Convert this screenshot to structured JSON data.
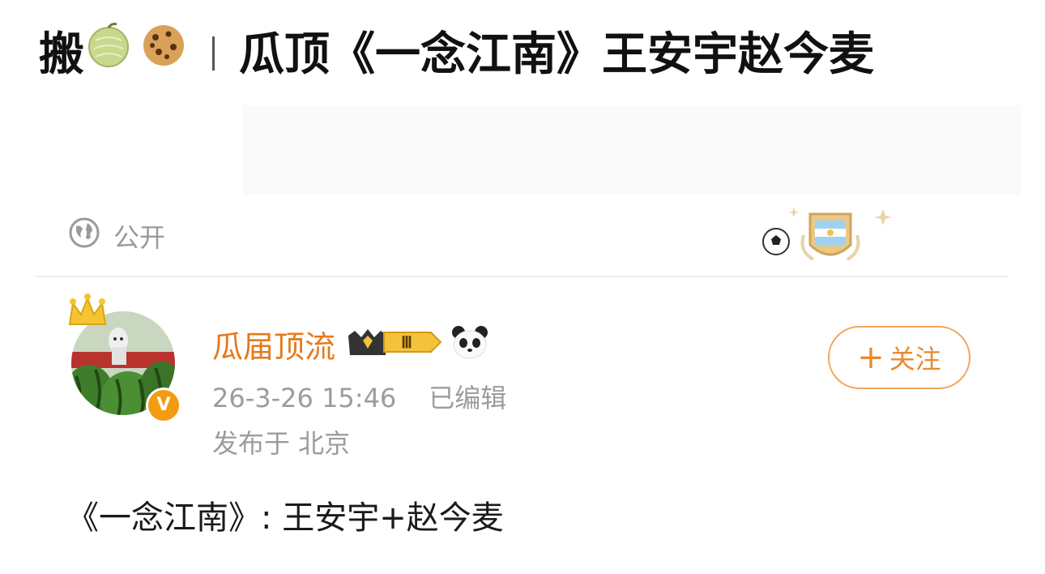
{
  "title": {
    "prefix": "搬",
    "emoji_1": "melon-emoji",
    "emoji_2": "cookie-emoji",
    "text": "瓜顶《一念江南》王安宇赵今麦"
  },
  "visibility": {
    "icon": "globe-icon",
    "label": "公开"
  },
  "post": {
    "username": "瓜届顶流",
    "level_badge": "Ⅲ",
    "timestamp": "26-3-26 15:46",
    "edited_label": "已编辑",
    "location": "发布于 北京",
    "follow_label": "关注",
    "verified_mark": "V",
    "body": "《一念江南》: 王安宇+赵今麦"
  },
  "colors": {
    "username": "#e47a1b",
    "follow_border": "#f2a55c",
    "follow_text": "#e98a2f",
    "meta": "#9c9c9c"
  }
}
